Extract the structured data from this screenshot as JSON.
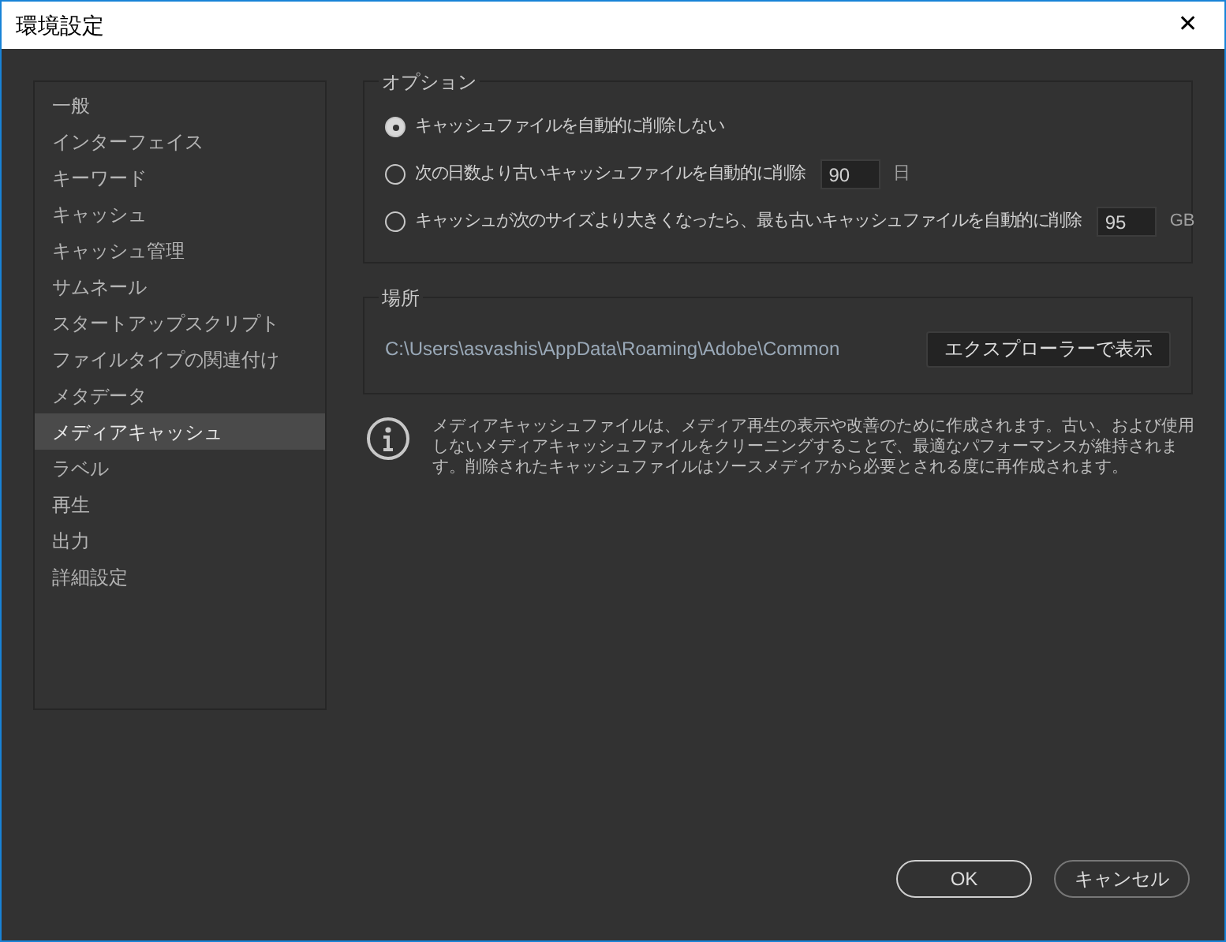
{
  "window": {
    "title": "環境設定",
    "close": "✕"
  },
  "sidebar": {
    "items": [
      {
        "label": "一般",
        "selected": false
      },
      {
        "label": "インターフェイス",
        "selected": false
      },
      {
        "label": "キーワード",
        "selected": false
      },
      {
        "label": "キャッシュ",
        "selected": false
      },
      {
        "label": "キャッシュ管理",
        "selected": false
      },
      {
        "label": "サムネール",
        "selected": false
      },
      {
        "label": "スタートアップスクリプト",
        "selected": false
      },
      {
        "label": "ファイルタイプの関連付け",
        "selected": false
      },
      {
        "label": "メタデータ",
        "selected": false
      },
      {
        "label": "メディアキャッシュ",
        "selected": true
      },
      {
        "label": "ラベル",
        "selected": false
      },
      {
        "label": "再生",
        "selected": false
      },
      {
        "label": "出力",
        "selected": false
      },
      {
        "label": "詳細設定",
        "selected": false
      }
    ]
  },
  "options": {
    "title": "オプション",
    "radios": [
      {
        "label": "キャッシュファイルを自動的に削除しない",
        "selected": true
      },
      {
        "label": "次の日数より古いキャッシュファイルを自動的に削除",
        "selected": false,
        "value": "90",
        "unit": "日"
      },
      {
        "label": "キャッシュが次のサイズより大きくなったら、最も古いキャッシュファイルを自動的に削除",
        "selected": false,
        "value": "95",
        "unit": "GB"
      }
    ]
  },
  "location": {
    "title": "場所",
    "path": "C:\\Users\\asvashis\\AppData\\Roaming\\Adobe\\Common",
    "button": "エクスプローラーで表示"
  },
  "info": "メディアキャッシュファイルは、メディア再生の表示や改善のために作成されます。古い、および使用しないメディアキャッシュファイルをクリーニングすることで、最適なパフォーマンスが維持されます。削除されたキャッシュファイルはソースメディアから必要とされる度に再作成されます。",
  "buttons": [
    "OK",
    "キャンセル"
  ]
}
